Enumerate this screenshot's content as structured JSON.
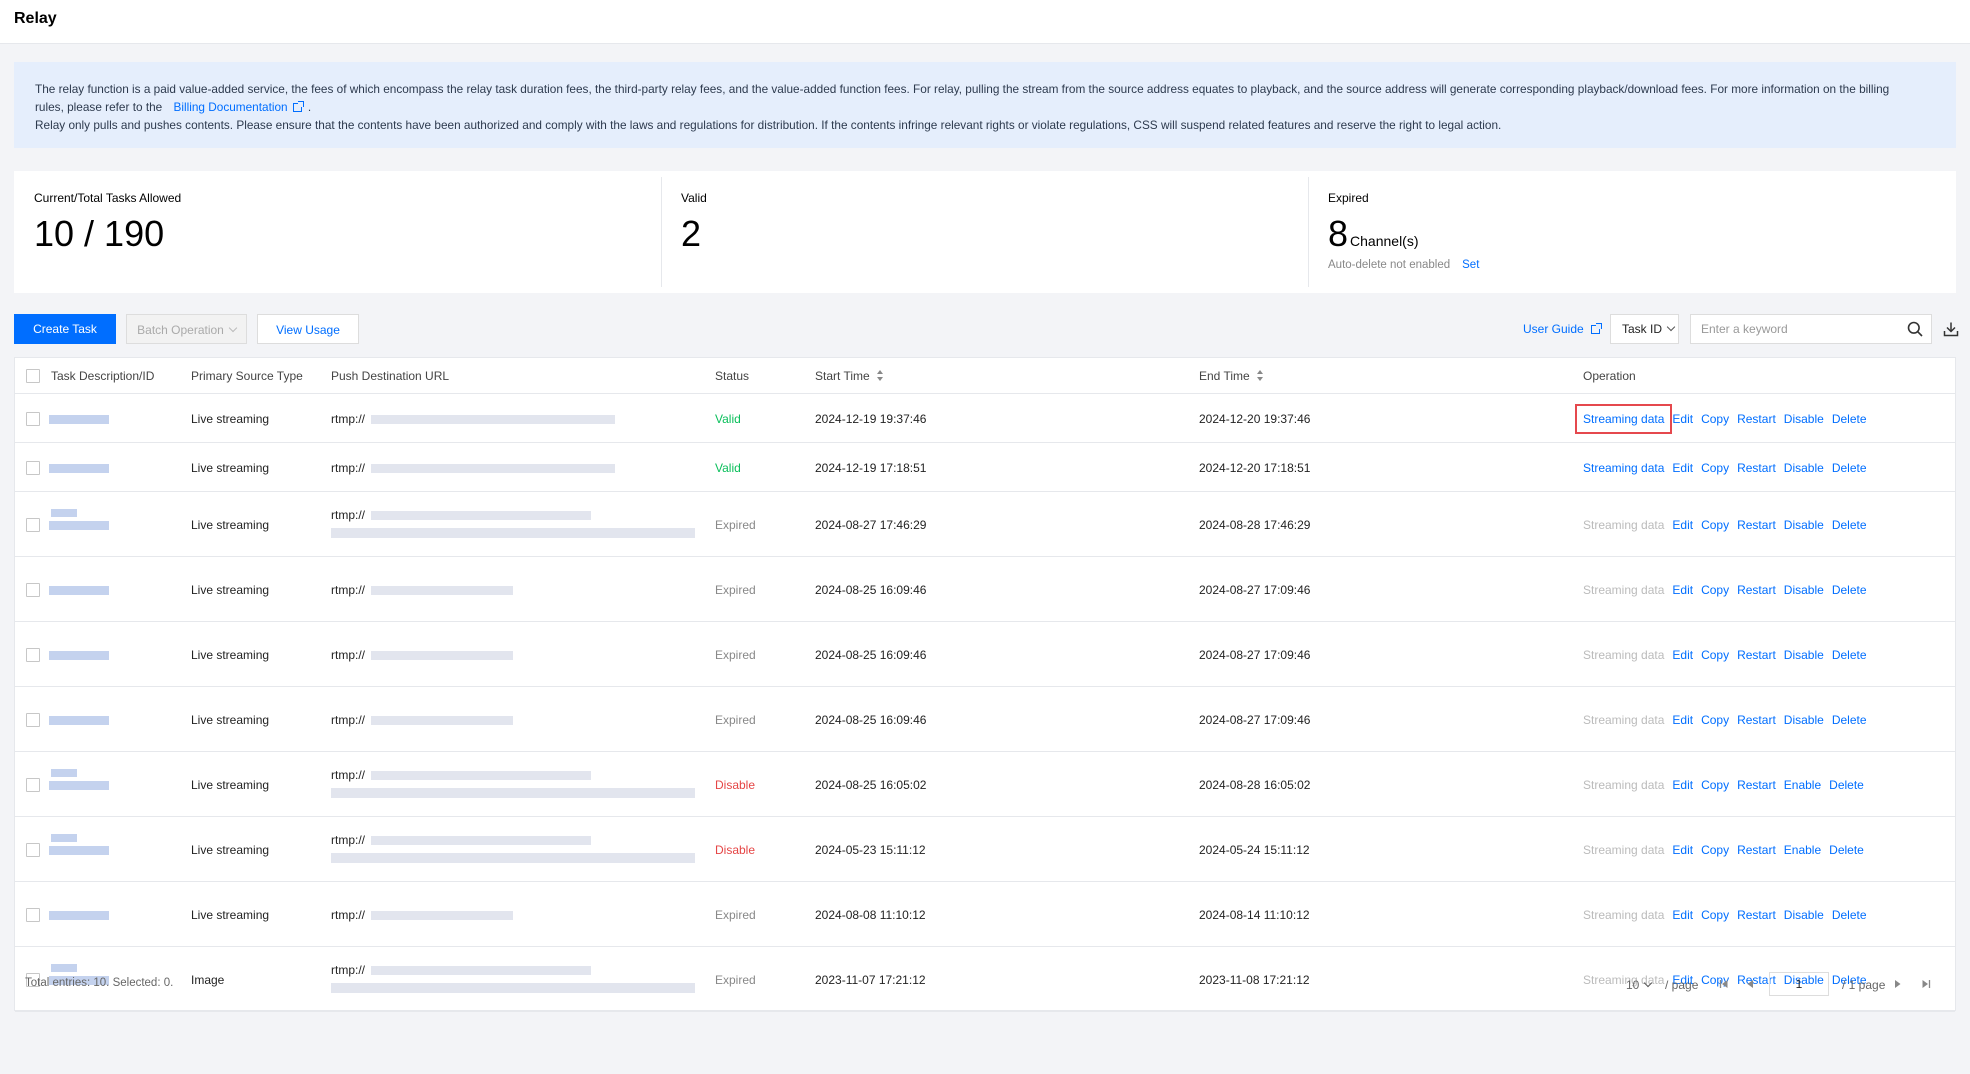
{
  "page": {
    "title": "Relay"
  },
  "notice": {
    "line1": "The relay function is a paid value-added service, the fees of which encompass the relay task duration fees, the third-party relay fees, and the value-added function fees. For relay, pulling the stream from the source address equates to playback, and the source address will generate corresponding playback/download fees. For more information on the billing",
    "line2_prefix": "rules, please refer to the",
    "link": "Billing Documentation",
    "line2_suffix": ".",
    "line3": "Relay only pulls and pushes contents. Please ensure that the contents have been authorized and comply with the laws and regulations for distribution. If the contents infringe relevant rights or violate regulations, CSS will suspend related features and reserve the right to legal action."
  },
  "stats": {
    "tasks": {
      "label": "Current/Total Tasks Allowed",
      "value": "10 / 190"
    },
    "valid": {
      "label": "Valid",
      "value": "2"
    },
    "expired": {
      "label": "Expired",
      "value": "8",
      "unit": "Channel(s)",
      "auto_delete": "Auto-delete not enabled",
      "set": "Set"
    }
  },
  "toolbar": {
    "create": "Create Task",
    "batch": "Batch Operation",
    "usage": "View Usage",
    "guide": "User Guide",
    "filter": "Task ID",
    "search_placeholder": "Enter a keyword"
  },
  "table": {
    "headers": {
      "task": "Task Description/ID",
      "source": "Primary Source Type",
      "dest": "Push Destination URL",
      "status": "Status",
      "start": "Start Time",
      "end": "End Time",
      "operation": "Operation"
    },
    "rows": [
      {
        "source": "Live streaming",
        "url": "rtmp://",
        "status": "Valid",
        "start": "2024-12-19 19:37:46",
        "end": "2024-12-20 19:37:46",
        "ops": [
          "Streaming data",
          "Edit",
          "Copy",
          "Restart",
          "Disable",
          "Delete"
        ]
      },
      {
        "source": "Live streaming",
        "url": "rtmp://",
        "status": "Valid",
        "start": "2024-12-19 17:18:51",
        "end": "2024-12-20 17:18:51",
        "ops": [
          "Streaming data",
          "Edit",
          "Copy",
          "Restart",
          "Disable",
          "Delete"
        ]
      },
      {
        "source": "Live streaming",
        "url": "rtmp://",
        "status": "Expired",
        "start": "2024-08-27 17:46:29",
        "end": "2024-08-28 17:46:29",
        "ops": [
          "Streaming data",
          "Edit",
          "Copy",
          "Restart",
          "Disable",
          "Delete"
        ]
      },
      {
        "source": "Live streaming",
        "url": "rtmp://",
        "status": "Expired",
        "start": "2024-08-25 16:09:46",
        "end": "2024-08-27 17:09:46",
        "ops": [
          "Streaming data",
          "Edit",
          "Copy",
          "Restart",
          "Disable",
          "Delete"
        ]
      },
      {
        "source": "Live streaming",
        "url": "rtmp://",
        "status": "Expired",
        "start": "2024-08-25 16:09:46",
        "end": "2024-08-27 17:09:46",
        "ops": [
          "Streaming data",
          "Edit",
          "Copy",
          "Restart",
          "Disable",
          "Delete"
        ]
      },
      {
        "source": "Live streaming",
        "url": "rtmp://",
        "status": "Expired",
        "start": "2024-08-25 16:09:46",
        "end": "2024-08-27 17:09:46",
        "ops": [
          "Streaming data",
          "Edit",
          "Copy",
          "Restart",
          "Disable",
          "Delete"
        ]
      },
      {
        "source": "Live streaming",
        "url": "rtmp://",
        "status": "Disable",
        "start": "2024-08-25 16:05:02",
        "end": "2024-08-28 16:05:02",
        "ops": [
          "Streaming data",
          "Edit",
          "Copy",
          "Restart",
          "Enable",
          "Delete"
        ]
      },
      {
        "source": "Live streaming",
        "url": "rtmp://",
        "status": "Disable",
        "start": "2024-05-23 15:11:12",
        "end": "2024-05-24 15:11:12",
        "ops": [
          "Streaming data",
          "Edit",
          "Copy",
          "Restart",
          "Enable",
          "Delete"
        ]
      },
      {
        "source": "Live streaming",
        "url": "rtmp://",
        "status": "Expired",
        "start": "2024-08-08 11:10:12",
        "end": "2024-08-14 11:10:12",
        "ops": [
          "Streaming data",
          "Edit",
          "Copy",
          "Restart",
          "Disable",
          "Delete"
        ]
      },
      {
        "source": "Image",
        "url": "rtmp://",
        "status": "Expired",
        "start": "2023-11-07 17:21:12",
        "end": "2023-11-08 17:21:12",
        "ops": [
          "Streaming data",
          "Edit",
          "Copy",
          "Restart",
          "Disable",
          "Delete"
        ]
      }
    ]
  },
  "footer": {
    "total": "Total entries: 10. Selected: 0.",
    "page_size": "10",
    "per_page": "/ page",
    "page": "1",
    "pages": "/ 1 page"
  },
  "colors": {
    "primary": "#006eff",
    "valid": "#0abf5b",
    "disable": "#e54545",
    "highlight": "#e5484d"
  },
  "icons": [
    "external-link-icon",
    "chevron-down-icon",
    "search-icon",
    "download-icon",
    "sort-icon",
    "first-page-icon",
    "prev-page-icon",
    "next-page-icon",
    "last-page-icon"
  ]
}
